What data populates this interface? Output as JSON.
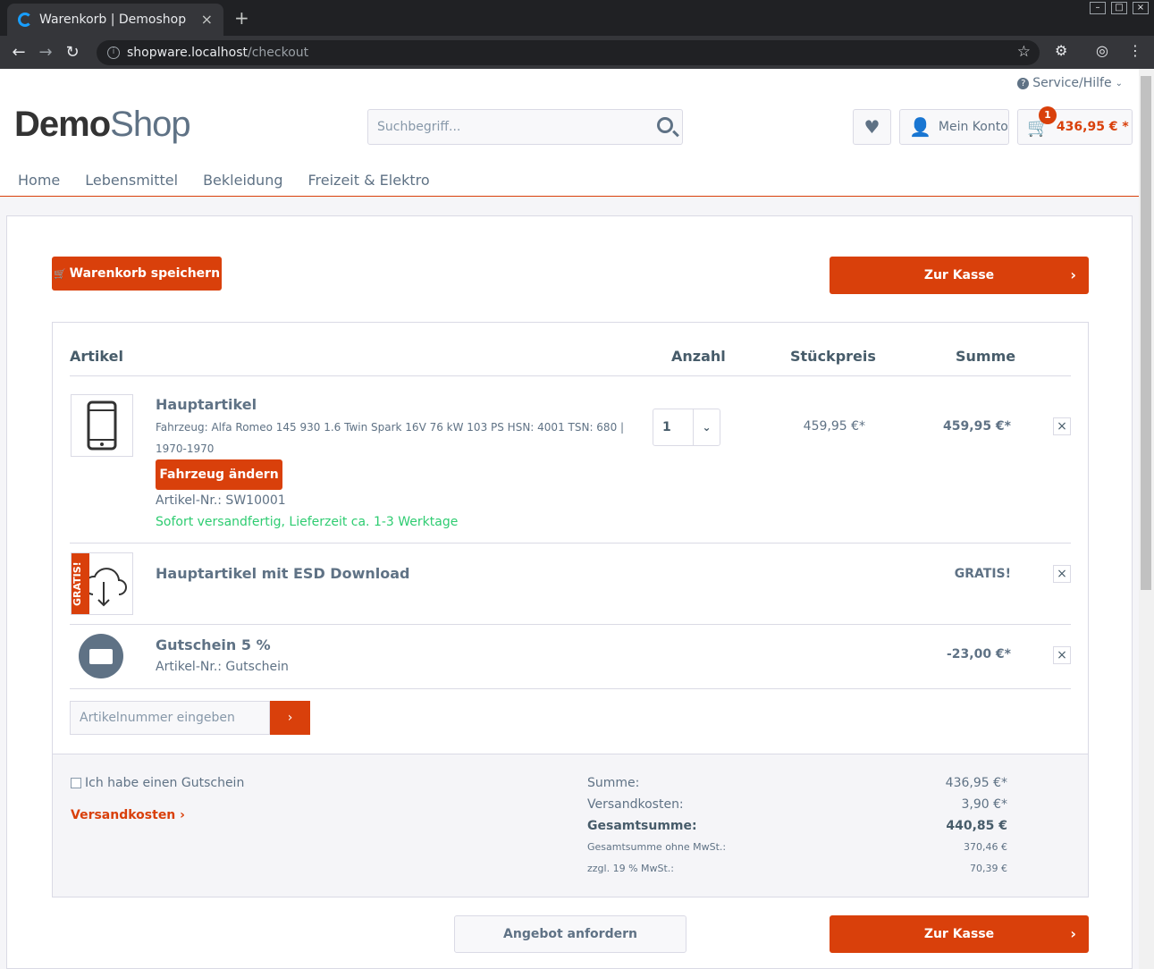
{
  "browser": {
    "tab_title": "Warenkorb | Demoshop",
    "url_host": "shopware.localhost",
    "url_path": "/checkout",
    "close": "×",
    "new_tab": "+"
  },
  "header": {
    "service": "Service/Hilfe",
    "logo_demo": "Demo",
    "logo_shop": "Shop",
    "search_placeholder": "Suchbegriff...",
    "account": "Mein Konto",
    "cart_total": "436,95 € *",
    "cart_count": "1"
  },
  "nav": [
    "Home",
    "Lebensmittel",
    "Bekleidung",
    "Freizeit & Elektro"
  ],
  "actions": {
    "save": "Warenkorb speichern",
    "checkout": "Zur Kasse",
    "offer": "Angebot anfordern"
  },
  "table": {
    "col_article": "Artikel",
    "col_qty": "Anzahl",
    "col_price": "Stückpreis",
    "col_sum": "Summe"
  },
  "items": [
    {
      "title": "Hauptartikel",
      "vehicle": "Fahrzeug: Alfa Romeo 145 930 1.6 Twin Spark 16V 76 kW 103 PS HSN: 4001 TSN: 680 |",
      "years": "1970-1970",
      "change": "Fahrzeug ändern",
      "sku": "Artikel-Nr.: SW10001",
      "delivery": "Sofort versandfertig, Lieferzeit ca. 1-3 Werktage",
      "qty": "1",
      "price": "459,95 €*",
      "sum": "459,95 €*"
    },
    {
      "title": "Hauptartikel mit ESD Download",
      "ribbon": "GRATIS!",
      "sum": "GRATIS!"
    },
    {
      "title": "Gutschein 5 %",
      "sku": "Artikel-Nr.: Gutschein",
      "sum": "-23,00 €*"
    }
  ],
  "add_article_placeholder": "Artikelnummer eingeben",
  "footer": {
    "voucher": "Ich habe einen Gutschein",
    "shipping_link": "Versandkosten ›"
  },
  "totals": [
    {
      "label": "Summe:",
      "value": "436,95 €*"
    },
    {
      "label": "Versandkosten:",
      "value": "3,90 €*"
    },
    {
      "label": "Gesamtsumme:",
      "value": "440,85 €"
    },
    {
      "label": "Gesamtsumme ohne MwSt.:",
      "value": "370,46 €"
    },
    {
      "label": "zzgl. 19 % MwSt.:",
      "value": "70,39 €"
    }
  ]
}
